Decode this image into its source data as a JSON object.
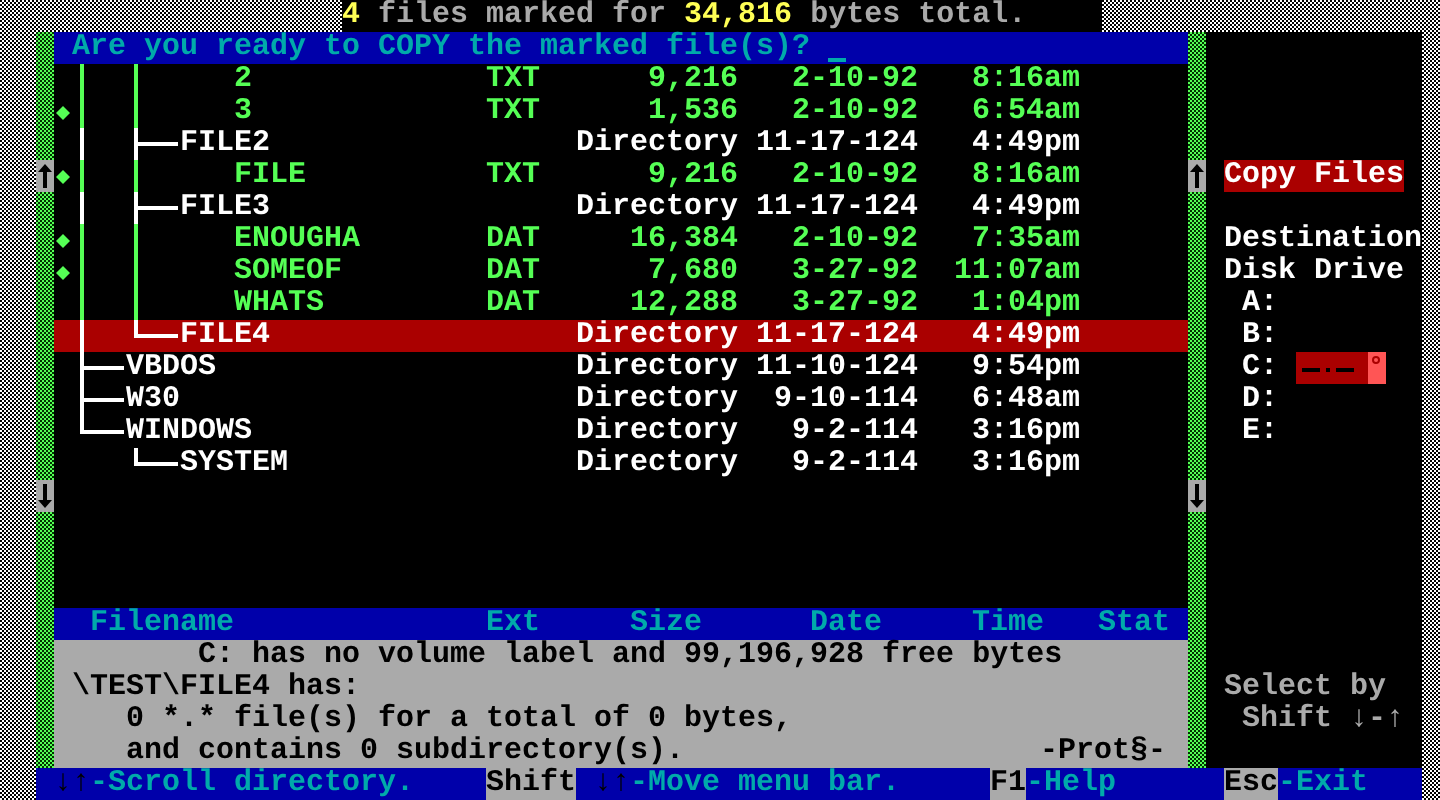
{
  "status": {
    "count": "4",
    "middle": "files marked for",
    "total": "34,816",
    "suffix": "bytes total."
  },
  "prompt": {
    "text": "Are you ready to COPY the marked file(s)?",
    "cursor": true
  },
  "tree": [
    {
      "kind": "hidden_dir",
      "children": [
        {
          "kind": "hidden_dir",
          "children": [
            {
              "kind": "file",
              "name": "2",
              "ext": "TXT",
              "size": "9,216",
              "date": "2-10-92",
              "time": "8:16am",
              "marked": false,
              "selected": false
            },
            {
              "kind": "file",
              "name": "3",
              "ext": "TXT",
              "size": "1,536",
              "date": "2-10-92",
              "time": "6:54am",
              "marked": true,
              "selected": false
            }
          ]
        },
        {
          "kind": "dir",
          "name": "FILE2",
          "size": "Directory",
          "date": "11-17-124",
          "time": "4:49pm",
          "marked": false,
          "selected": false,
          "children": [
            {
              "kind": "file",
              "name": "FILE",
              "ext": "TXT",
              "size": "9,216",
              "date": "2-10-92",
              "time": "8:16am",
              "marked": true,
              "selected": false
            }
          ]
        },
        {
          "kind": "dir",
          "name": "FILE3",
          "size": "Directory",
          "date": "11-17-124",
          "time": "4:49pm",
          "marked": false,
          "selected": false,
          "children": [
            {
              "kind": "file",
              "name": "ENOUGHA",
              "ext": "DAT",
              "size": "16,384",
              "date": "2-10-92",
              "time": "7:35am",
              "marked": true,
              "selected": false
            },
            {
              "kind": "file",
              "name": "SOMEOF",
              "ext": "DAT",
              "size": "7,680",
              "date": "3-27-92",
              "time": "11:07am",
              "marked": true,
              "selected": false
            },
            {
              "kind": "file",
              "name": "WHATS",
              "ext": "DAT",
              "size": "12,288",
              "date": "3-27-92",
              "time": "1:04pm",
              "marked": false,
              "selected": false
            }
          ]
        },
        {
          "kind": "dir",
          "name": "FILE4",
          "size": "Directory",
          "date": "11-17-124",
          "time": "4:49pm",
          "marked": false,
          "selected": true
        }
      ]
    },
    {
      "kind": "dir",
      "name": "VBDOS",
      "size": "Directory",
      "date": "11-10-124",
      "time": "9:54pm",
      "marked": false,
      "selected": false
    },
    {
      "kind": "dir",
      "name": "W30",
      "size": "Directory",
      "date": "9-10-114",
      "time": "6:48am",
      "marked": false,
      "selected": false
    },
    {
      "kind": "dir",
      "name": "WINDOWS",
      "size": "Directory",
      "date": "9-2-114",
      "time": "3:16pm",
      "marked": false,
      "selected": false,
      "children": [
        {
          "kind": "dir",
          "name": "SYSTEM",
          "size": "Directory",
          "date": "9-2-114",
          "time": "3:16pm",
          "marked": false,
          "selected": false
        }
      ]
    }
  ],
  "columns": [
    "Filename",
    "Ext",
    "Size",
    "Date",
    "Time",
    "Stat"
  ],
  "info": {
    "line_1": "C: has no volume label and 99,196,928 free bytes",
    "line_2": "\\TEST\\FILE4 has:",
    "line_3": "0 *.* file(s) for a total of 0 bytes,",
    "line_4": "and contains 0 subdirectory(s).",
    "flag": "-Prot§-"
  },
  "side_panel": {
    "title": "Copy Files",
    "heading_1": "Destination",
    "heading_2": "Disk Drive",
    "drives": [
      {
        "label": "A:",
        "selected": false
      },
      {
        "label": "B:",
        "selected": false
      },
      {
        "label": "C:",
        "selected": true
      },
      {
        "label": "D:",
        "selected": false
      },
      {
        "label": "E:",
        "selected": false
      }
    ],
    "hint_1": "Select by",
    "hint_2": "Shift ↓-↑"
  },
  "keys": [
    {
      "key": "↓↑",
      "highlighted": false,
      "label": "-Scroll directory."
    },
    {
      "key": "Shift",
      "highlighted": true
    },
    {
      "key": "↓↑",
      "highlighted": false,
      "label": "-Move menu bar."
    },
    {
      "key": "F1",
      "highlighted": true,
      "label": "-Help"
    },
    {
      "key": "Esc",
      "highlighted": true,
      "label": "-Exit"
    }
  ]
}
